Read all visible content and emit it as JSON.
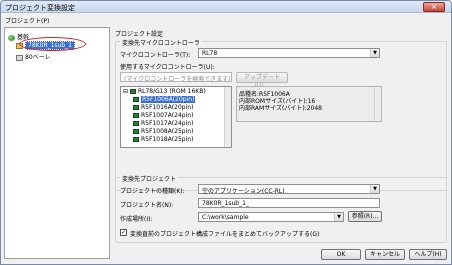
{
  "window": {
    "title": "プロジェクト変換設定",
    "close": "×"
  },
  "menu": {
    "label": "プロジェクト(P)"
  },
  "tree": {
    "root": "基幹",
    "project": "78K0R_1sub_1",
    "sub": "80ベーレ"
  },
  "settings": {
    "header": "プロジェクト設定"
  },
  "target_mc": {
    "group": "変換先マイクロコントローラ",
    "mc_label": "マイクロコントローラ(T):",
    "mc_value": "RL78",
    "used_label": "使用するマイクロコントローラ(U):",
    "search_placeholder": "(マイクロコントローラを検索できます)",
    "update_button": "アップデート(U)...",
    "list_group": "RL78/G13 (ROM 16KB)",
    "items": [
      "R5F1006A(20pin)",
      "R5F1016A(20pin)",
      "R5F1007A(24pin)",
      "R5F1017A(24pin)",
      "R5F1008A(25pin)",
      "R5F1018A(25pin)"
    ],
    "selected_index": 0,
    "info": [
      "品種名:R5F1006A",
      "内部ROMサイズ(バイト):16",
      "内部RAMサイズ(バイト):2048"
    ]
  },
  "target_project": {
    "group": "変換先プロジェクト",
    "type_label": "プロジェクトの種類(K):",
    "type_value": "空のアプリケーション(CC-RL)",
    "name_label": "プロジェクト名(N):",
    "name_value": "78K0R_1sub_1_",
    "location_label": "作成場所(I):",
    "location_value": "C:\\work\\sample",
    "browse_button": "参照(R)...",
    "backup_label": "変換直前のプロジェクト構成ファイルをまとめてバックアップする(G)",
    "backup_checked": true
  },
  "buttons": {
    "ok": "OK",
    "cancel": "キャンセル",
    "help": "ヘルプ(H)"
  }
}
